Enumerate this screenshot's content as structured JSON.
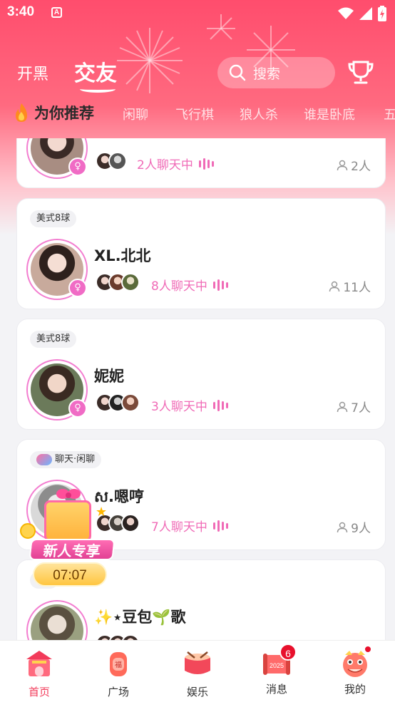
{
  "status_bar": {
    "time": "3:40",
    "app_icon_letter": "A"
  },
  "top_nav": {
    "tab_inactive": "开黑",
    "tab_active": "交友",
    "search_placeholder": "搜索"
  },
  "categories": {
    "active": "为你推荐",
    "items": [
      "闲聊",
      "飞行棋",
      "狼人杀",
      "谁是卧底",
      "五"
    ]
  },
  "rooms": [
    {
      "tag": "",
      "name": "",
      "chatting": "2人聊天中",
      "people": "2人"
    },
    {
      "tag": "美式8球",
      "name": "XL.北北",
      "chatting": "8人聊天中",
      "people": "11人"
    },
    {
      "tag": "美式8球",
      "name": "妮妮",
      "chatting": "3人聊天中",
      "people": "7人"
    },
    {
      "tag": "聊天·闲聊",
      "name": "ស.嗯哼",
      "chatting": "7人聊天中",
      "people": "9人"
    },
    {
      "tag": "",
      "name": "✨⋆豆包🌱歌",
      "chatting": "",
      "people": ""
    }
  ],
  "promo": {
    "label": "新人专享",
    "timer": "07:07"
  },
  "bottom_nav": {
    "items": [
      {
        "label": "首页",
        "active": true
      },
      {
        "label": "广场",
        "active": false
      },
      {
        "label": "娱乐",
        "active": false
      },
      {
        "label": "消息",
        "active": false,
        "badge": "6"
      },
      {
        "label": "我的",
        "active": false,
        "dot": true
      }
    ],
    "calendar_year": "2025"
  },
  "colors": {
    "brand": "#ff4d6d",
    "accent_pink": "#f06bb7",
    "active_nav": "#f23b5a"
  }
}
